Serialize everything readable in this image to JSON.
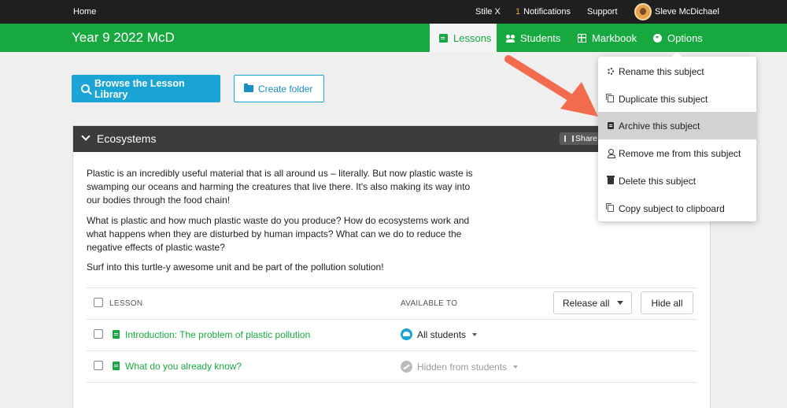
{
  "topbar": {
    "home": "Home",
    "product": "Stile X",
    "notification_count": "1",
    "notifications": "Notifications",
    "support": "Support",
    "user_name": "Sleve McDichael"
  },
  "header": {
    "subject_title": "Year 9 2022 McD",
    "tabs": {
      "lessons": "Lessons",
      "students": "Students",
      "markbook": "Markbook",
      "options": "Options"
    },
    "active_tab": "lessons"
  },
  "actions": {
    "browse": "Browse the Lesson Library",
    "create_folder": "Create folder"
  },
  "folder": {
    "title": "Ecosystems",
    "share": "Share",
    "description": [
      "Plastic is an incredibly useful material that is all around us – literally. But now plastic waste is swamping our oceans and harming the creatures that live there. It's also making its way into our bodies through the food chain!",
      "What is plastic and how much plastic waste do you produce? How do ecosystems work and what happens when they are disturbed by human impacts? What can we do to reduce the negative effects of plastic waste?",
      "Surf into this turtle-y awesome unit and be part of the pollution solution!"
    ],
    "table": {
      "col_lesson": "LESSON",
      "col_available": "AVAILABLE TO",
      "release_all": "Release all",
      "hide_all": "Hide all"
    },
    "lessons": [
      {
        "title": "Introduction: The problem of plastic pollution",
        "availability": "All students"
      },
      {
        "title": "What do you already know?",
        "availability": "Hidden from students"
      }
    ]
  },
  "options_menu": {
    "items": [
      {
        "label": "Rename this subject",
        "icon": "gear-icon"
      },
      {
        "label": "Duplicate this subject",
        "icon": "copy-icon"
      },
      {
        "label": "Archive this subject",
        "icon": "archive-icon"
      },
      {
        "label": "Remove me from this subject",
        "icon": "user-icon"
      },
      {
        "label": "Delete this subject",
        "icon": "trash-icon"
      },
      {
        "label": "Copy subject to clipboard",
        "icon": "clipboard-icon"
      }
    ],
    "highlighted": "Archive this subject"
  },
  "colors": {
    "brand_green": "#17a940",
    "accent_blue": "#1aa5d6",
    "topbar": "#1f1f1f",
    "annotation_arrow": "#f26b4e"
  }
}
